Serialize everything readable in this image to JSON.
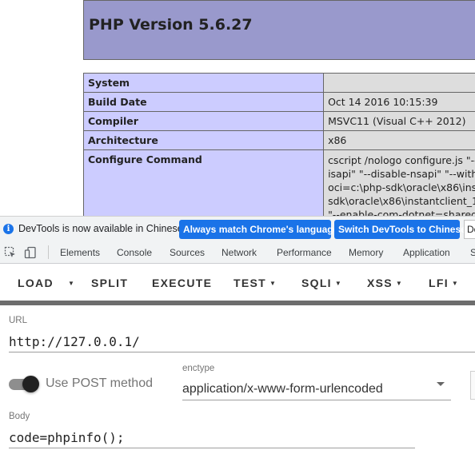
{
  "php": {
    "title": "PHP Version 5.6.27",
    "rows": [
      {
        "label": "System",
        "value": ""
      },
      {
        "label": "Build Date",
        "value": "Oct 14 2016 10:15:39"
      },
      {
        "label": "Compiler",
        "value": "MSVC11 (Visual C++ 2012)"
      },
      {
        "label": "Architecture",
        "value": "x86"
      },
      {
        "label": "Configure Command",
        "lines": [
          "cscript /nologo configure.js \"--",
          "isapi\" \"--disable-nsapi\" \"--with",
          "oci=c:\\php-sdk\\oracle\\x86\\ins",
          "sdk\\oracle\\x86\\instantclient_1",
          "\"--enable-com-dotnet=shared"
        ]
      }
    ]
  },
  "devtools_infobar": {
    "message": "DevTools is now available in Chinese!",
    "primary_button": "Always match Chrome's language",
    "secondary_button": "Switch DevTools to Chinese",
    "partial_button": "Do"
  },
  "devtools_tabs": [
    "Elements",
    "Console",
    "Sources",
    "Network",
    "Performance",
    "Memory",
    "Application",
    "S"
  ],
  "hackbar": {
    "buttons": {
      "load": "LOAD",
      "split": "SPLIT",
      "execute": "EXECUTE",
      "test": "TEST",
      "sqli": "SQLI",
      "xss": "XSS",
      "lfi": "LFI"
    },
    "url_label": "URL",
    "url_value": "http://127.0.0.1/",
    "post_toggle_label": "Use POST method",
    "post_enabled": true,
    "enctype_label": "enctype",
    "enctype_value": "application/x-www-form-urlencoded",
    "body_label": "Body",
    "body_value": "code=phpinfo();"
  },
  "colors": {
    "php_header": "#9999cc",
    "php_label_cell": "#ccccff",
    "php_value_cell": "#dddddd",
    "accent_blue": "#1a73e8"
  }
}
